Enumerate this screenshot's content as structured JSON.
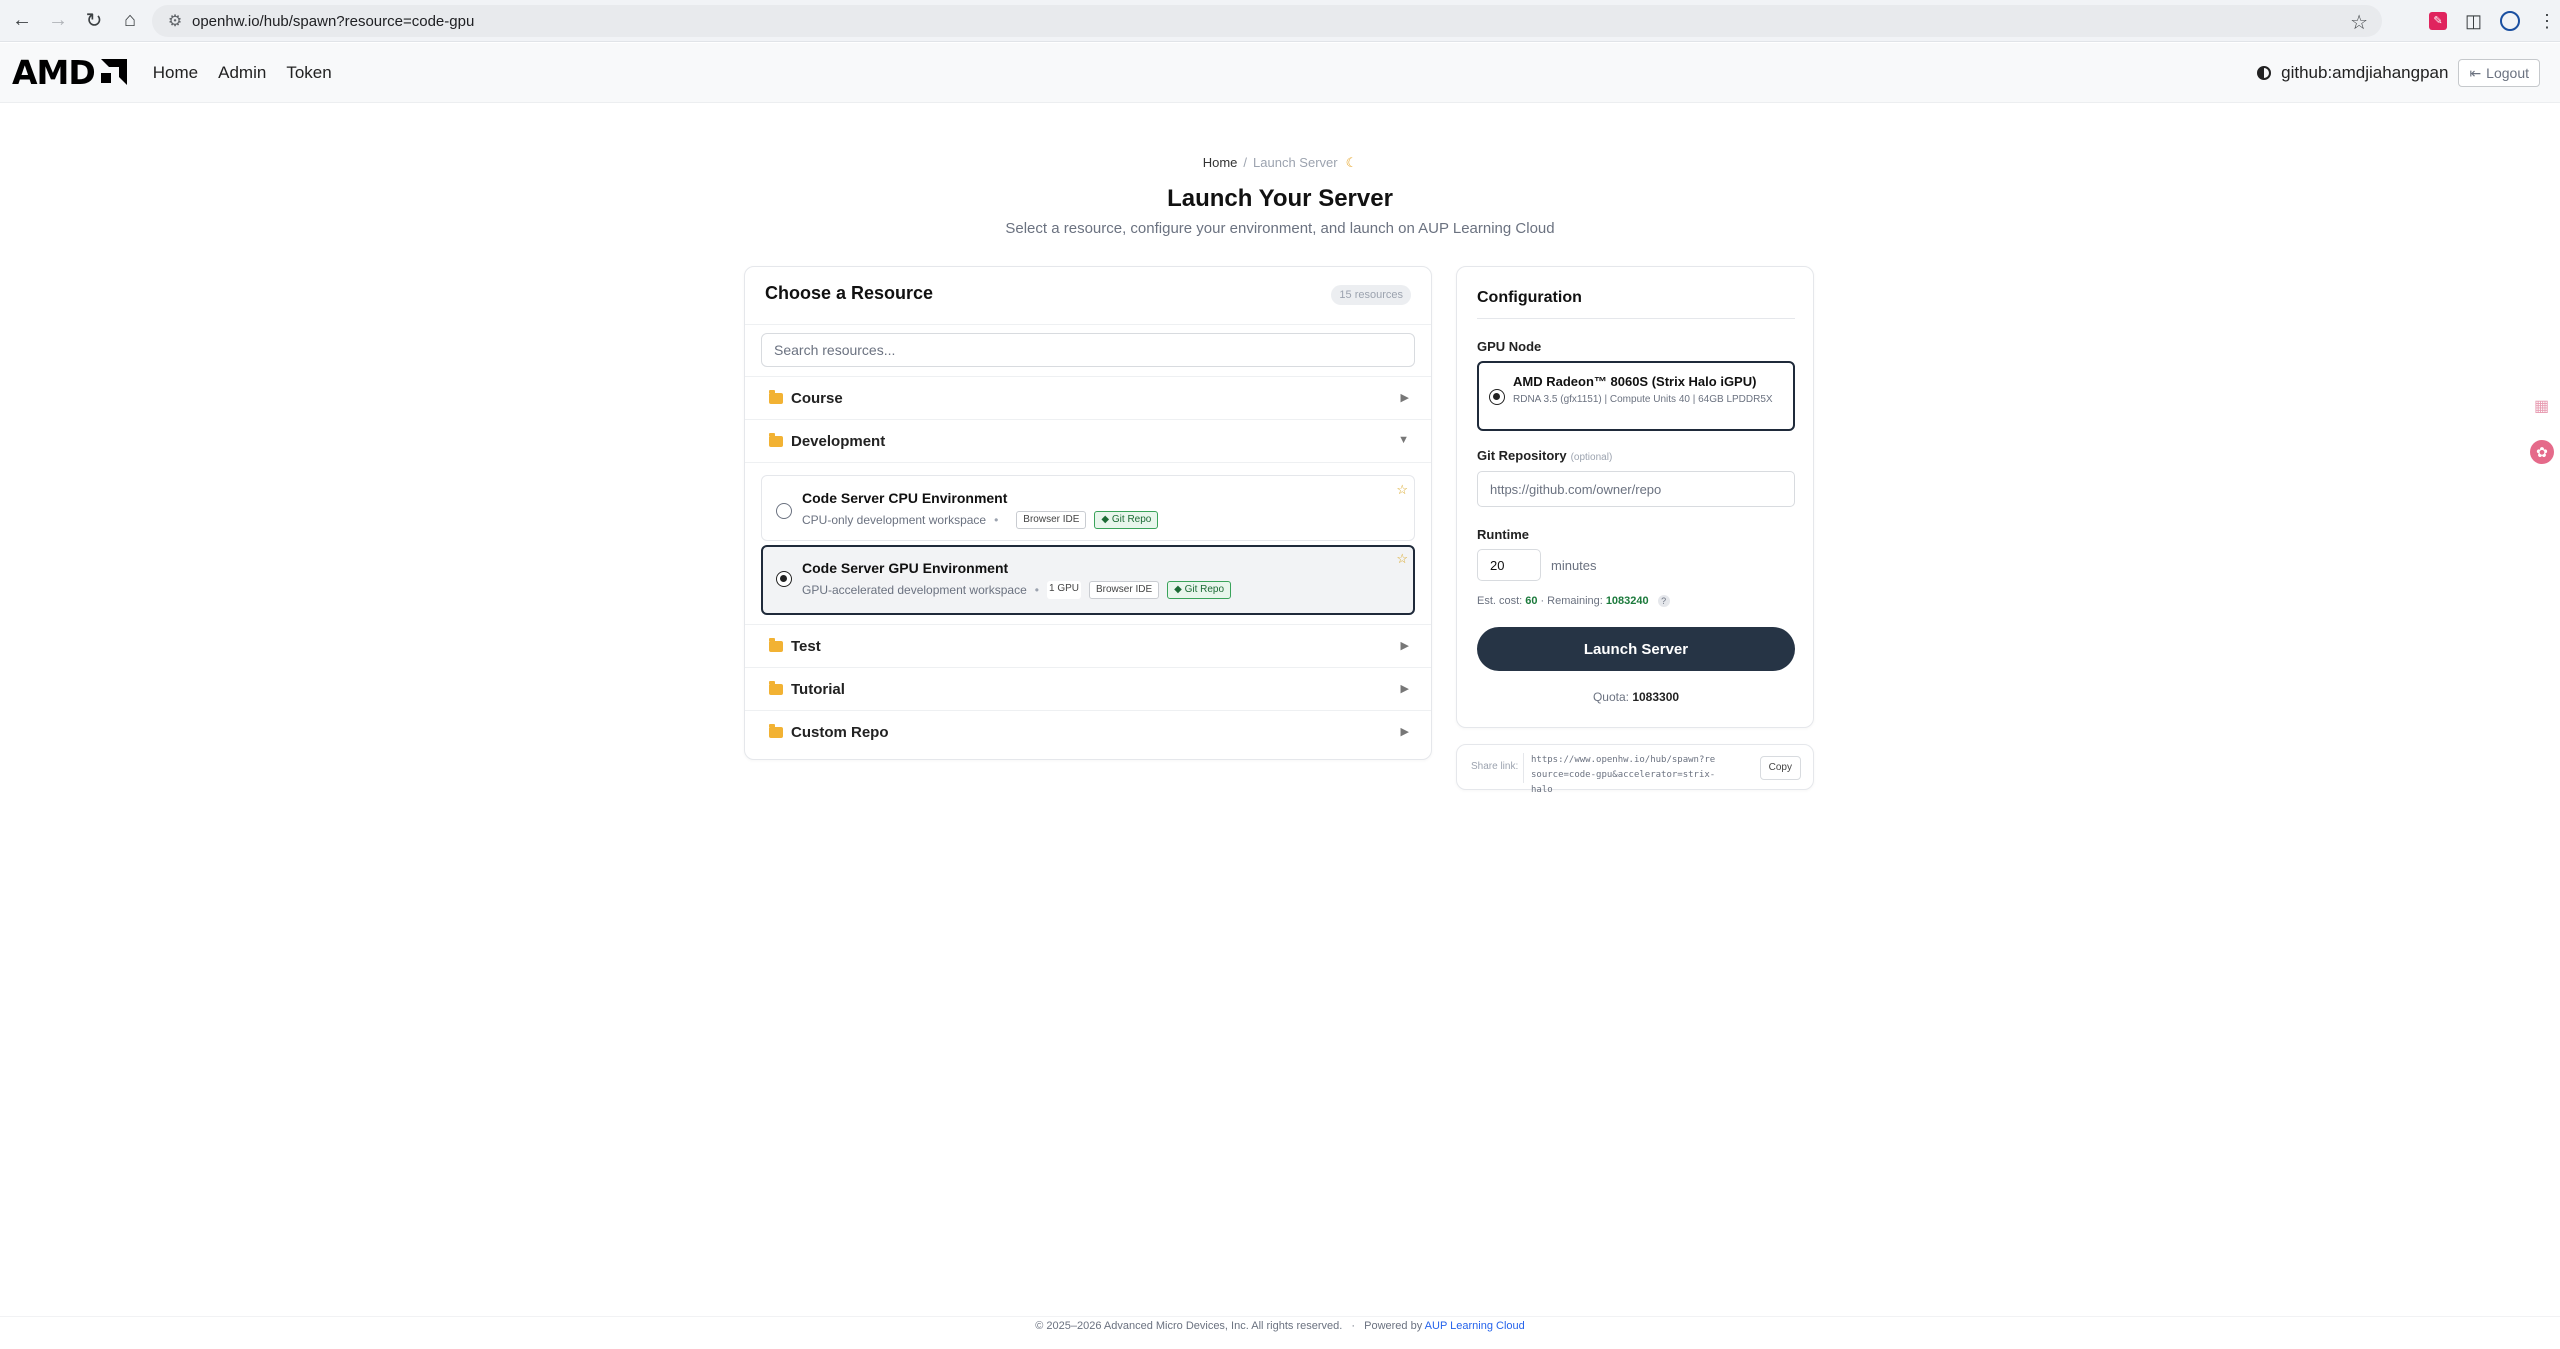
{
  "browser": {
    "url": "openhw.io/hub/spawn?resource=code-gpu"
  },
  "navbar": {
    "brand": "AMD",
    "links": [
      "Home",
      "Admin",
      "Token"
    ],
    "user": "github:amdjiahangpan",
    "logout_label": "Logout"
  },
  "header": {
    "breadcrumb_home": "Home",
    "breadcrumb_separator": "/",
    "breadcrumb_current": "Launch Server",
    "title": "Launch Your Server",
    "subtitle": "Select a resource, configure your environment, and launch on AUP Learning Cloud"
  },
  "resources": {
    "title": "Choose a Resource",
    "count": "15 resources",
    "search_placeholder": "Search resources...",
    "categories": [
      {
        "label": "Course",
        "expanded": false
      },
      {
        "label": "Development",
        "expanded": true
      },
      {
        "label": "Test",
        "expanded": false
      },
      {
        "label": "Tutorial",
        "expanded": false
      },
      {
        "label": "Custom Repo",
        "expanded": false
      }
    ],
    "items": [
      {
        "name": "Code Server CPU Environment",
        "description": "CPU-only development workspace",
        "gpu": "",
        "tag_ide": "Browser IDE",
        "tag_git": "Git Repo",
        "selected": false
      },
      {
        "name": "Code Server GPU Environment",
        "description": "GPU-accelerated development workspace",
        "gpu": "1 GPU",
        "tag_ide": "Browser IDE",
        "tag_git": "Git Repo",
        "selected": true
      }
    ]
  },
  "config": {
    "title": "Configuration",
    "gpu_label": "GPU Node",
    "gpu_name": "AMD Radeon™ 8060S (Strix Halo iGPU)",
    "gpu_desc": "RDNA 3.5 (gfx1151) | Compute Units 40 | 64GB LPDDR5X",
    "repo_label": "Git Repository",
    "repo_optional": "(optional)",
    "repo_placeholder": "https://github.com/owner/repo",
    "runtime_label": "Runtime",
    "runtime_value": "20",
    "runtime_unit": "minutes",
    "cost_label": "Est. cost:",
    "cost_value": "60",
    "remaining_label": "Remaining:",
    "remaining_value": "1083240",
    "help": "?",
    "launch_label": "Launch Server",
    "quota_label": "Quota:",
    "quota_value": "1083300"
  },
  "share": {
    "label": "Share link:",
    "url": "https://www.openhw.io/hub/spawn?resource=code-gpu&accelerator=strix-halo",
    "copy_label": "Copy"
  },
  "footer": {
    "copyright": "© 2025–2026 Advanced Micro Devices, Inc. All rights reserved.",
    "separator": "·",
    "powered_by": "Powered by",
    "powered_link": "AUP Learning Cloud"
  }
}
